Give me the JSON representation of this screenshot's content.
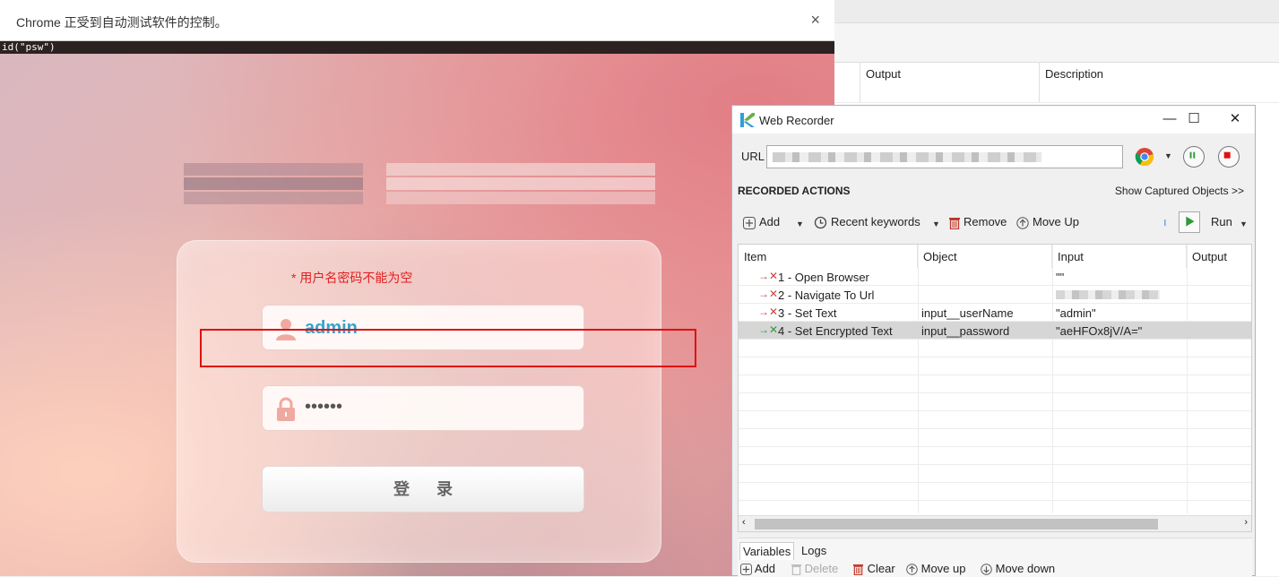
{
  "chrome": {
    "infobar_text": "Chrome 正受到自动测试软件的控制。",
    "close_glyph": "×",
    "locator_text": "id(\"psw\")"
  },
  "login": {
    "error": "* 用户名密码不能为空",
    "username": "admin",
    "password_mask": "••••••",
    "button_label": "登录"
  },
  "bg_table": {
    "headers": [
      "Output",
      "Description"
    ]
  },
  "recorder": {
    "title": "Web Recorder",
    "url_label": "URL",
    "section_title": "RECORDED ACTIONS",
    "show_captured": "Show Captured Objects >>",
    "toolbar": {
      "add": "Add",
      "recent": "Recent keywords",
      "remove": "Remove",
      "move_up": "Move Up",
      "run": "Run"
    },
    "columns": [
      "Item",
      "Object",
      "Input",
      "Output"
    ],
    "rows": [
      {
        "item": "1 - Open Browser",
        "object": "",
        "input": "\"\""
      },
      {
        "item": "2 - Navigate To Url",
        "object": "",
        "input": ""
      },
      {
        "item": "3 - Set Text",
        "object": "input__userName",
        "input": "\"admin\""
      },
      {
        "item": "4 - Set Encrypted Text",
        "object": "input__password",
        "input": "\"aeHFOx8jV/A=\""
      }
    ],
    "bottom_tabs": [
      "Variables",
      "Logs"
    ],
    "bottom_actions": {
      "add": "Add",
      "delete": "Delete",
      "clear": "Clear",
      "move_up": "Move up",
      "move_down": "Move down"
    }
  },
  "colors": {
    "error_red": "#e02020",
    "username_blue": "#3aa2cc",
    "highlight_red": "#e01010",
    "run_green": "#2e9a3a"
  }
}
